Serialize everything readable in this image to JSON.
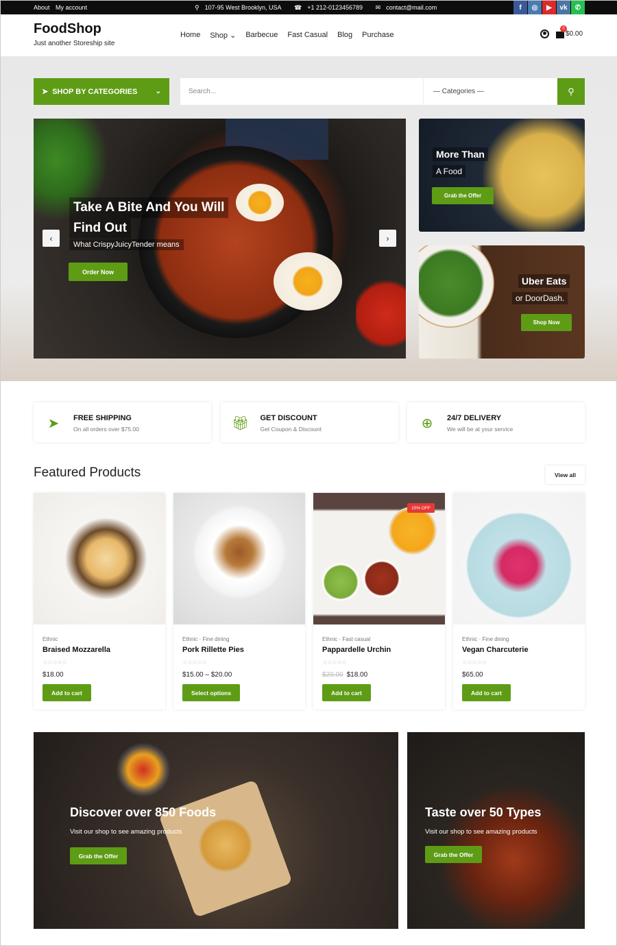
{
  "topbar": {
    "links": [
      "About",
      "My account"
    ],
    "address": "107-95 West Brooklyn, USA",
    "phone": "+1 212-0123456789",
    "email": "contact@mail.com",
    "social": [
      {
        "name": "facebook",
        "glyph": "f",
        "color": "#3b5998"
      },
      {
        "name": "instagram",
        "glyph": "◎",
        "color": "#4c7bb0"
      },
      {
        "name": "youtube",
        "glyph": "▶",
        "color": "#d92b2b"
      },
      {
        "name": "vk",
        "glyph": "vk",
        "color": "#4c75a3"
      },
      {
        "name": "whatsapp",
        "glyph": "✆",
        "color": "#25c150"
      }
    ]
  },
  "header": {
    "logo": "FoodShop",
    "tagline": "Just another Storeship site",
    "nav": [
      "Home",
      "Shop ⌄",
      "Barbecue",
      "Fast Casual",
      "Blog",
      "Purchase"
    ],
    "cart_count": "0",
    "cart_total": "$0.00"
  },
  "search": {
    "categories_button": "SHOP BY CATEGORIES",
    "placeholder": "Search...",
    "category_select": "— Categories —"
  },
  "hero": {
    "title_line1": "Take A Bite And You Will",
    "title_line2": "Find Out",
    "subtitle": "What CrispyJuicyTender means",
    "button": "Order Now",
    "prev": "‹",
    "next": "›"
  },
  "side_banners": [
    {
      "title": "More Than",
      "subtitle": "A Food",
      "button": "Grab the Offer"
    },
    {
      "title": "Uber Eats",
      "subtitle": "or DoorDash.",
      "button": "Shop Now"
    }
  ],
  "features": [
    {
      "icon": "paper-plane",
      "title": "FREE SHIPPING",
      "desc": "On all orders over $75.00"
    },
    {
      "icon": "gift",
      "title": "GET DISCOUNT",
      "desc": "Get Coupon & Discount"
    },
    {
      "icon": "life-ring",
      "title": "24/7 DELIVERY",
      "desc": "We will be at your service"
    }
  ],
  "featured": {
    "title": "Featured Products",
    "view_all": "View all",
    "products": [
      {
        "category": "Ethnic",
        "name": "Braised Mozzarella",
        "rating": 0,
        "stars": "☆☆☆☆☆",
        "old_price": "",
        "price": "$18.00",
        "button": "Add to cart",
        "sale": ""
      },
      {
        "category": "Ethnic · Fine dining",
        "name": "Pork Rillette Pies",
        "rating": 0,
        "stars": "☆☆☆☆☆",
        "old_price": "",
        "price": "$15.00 – $20.00",
        "button": "Select options",
        "sale": ""
      },
      {
        "category": "Ethnic · Fast casual",
        "name": "Pappardelle Urchin",
        "rating": 0,
        "stars": "☆☆☆☆☆",
        "old_price": "$20.00",
        "price": "$18.00",
        "button": "Add to cart",
        "sale": "10% OFF"
      },
      {
        "category": "Ethnic · Fine dining",
        "name": "Vegan Charcuterie",
        "rating": 0,
        "stars": "☆☆☆☆☆",
        "old_price": "",
        "price": "$65.00",
        "button": "Add to cart",
        "sale": ""
      }
    ]
  },
  "promo_banners": [
    {
      "title": "Discover over 850 Foods",
      "subtitle": "Visit our shop to see amazing products",
      "button": "Grab the Offer"
    },
    {
      "title": "Taste over 50 Types",
      "subtitle": "Visit our shop to see amazing products",
      "button": "Grab the Offer"
    }
  ],
  "colors": {
    "accent": "#5e9c16",
    "sale": "#e53935",
    "topbar": "#0d0d0d"
  }
}
